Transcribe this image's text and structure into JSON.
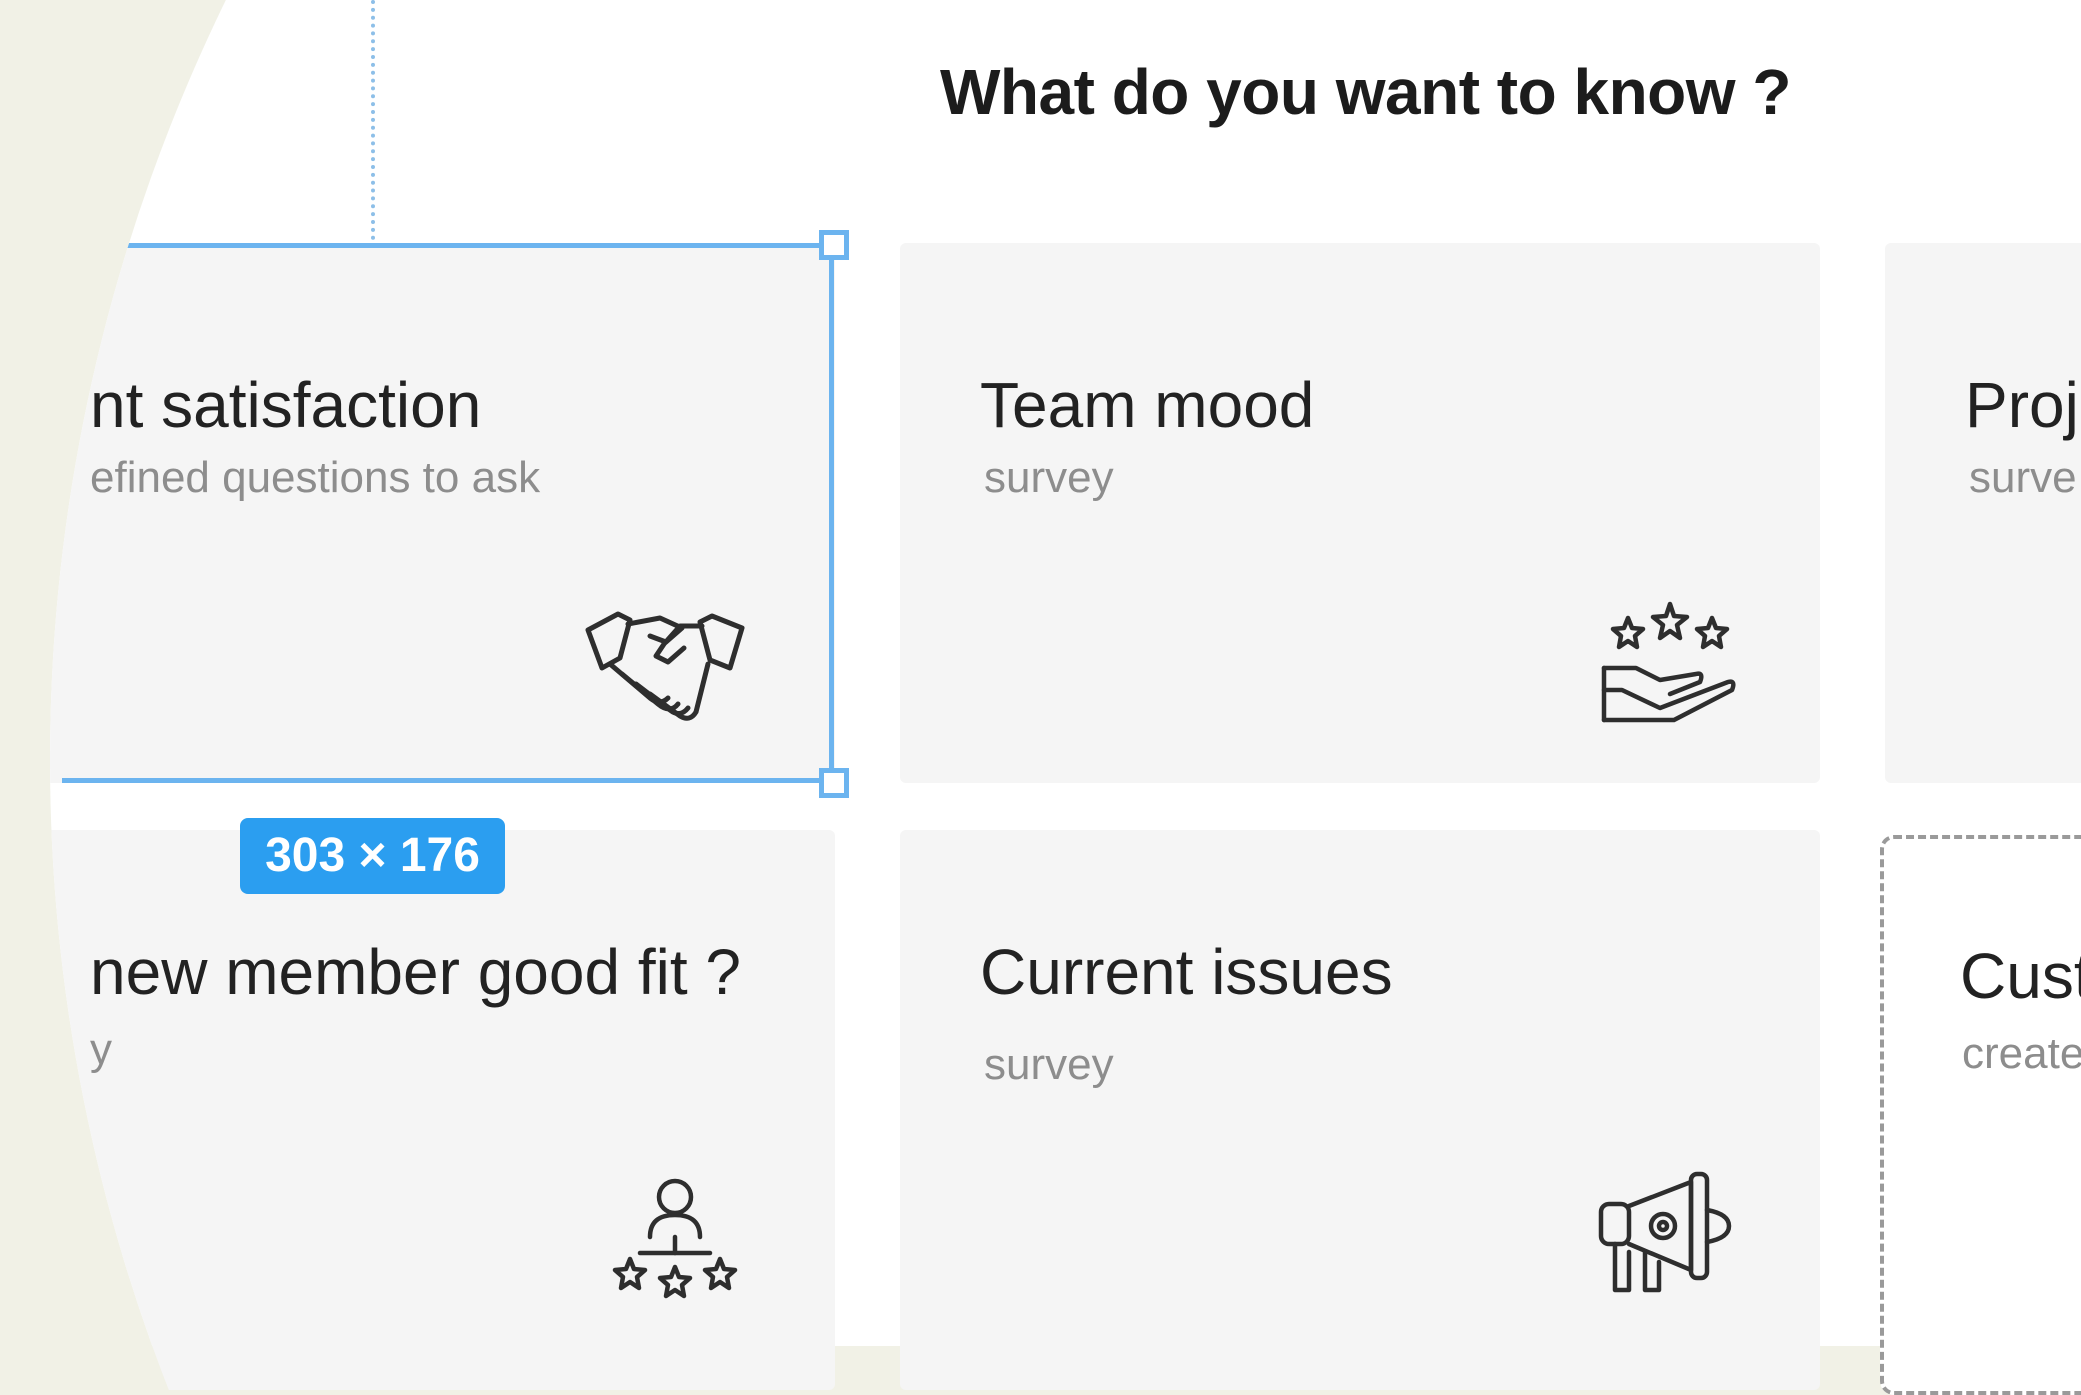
{
  "heading": "What do you want to know ?",
  "selection": {
    "size_label": "303 × 176"
  },
  "cards": [
    {
      "id": "client-satisfaction",
      "title": "nt satisfaction",
      "subtitle": "efined questions to ask",
      "icon": "handshake-icon"
    },
    {
      "id": "team-mood",
      "title": "Team mood",
      "subtitle": "survey",
      "icon": "hand-with-stars-icon"
    },
    {
      "id": "project",
      "title": "Proj",
      "subtitle": "surve",
      "icon": ""
    },
    {
      "id": "new-member-fit",
      "title": "new member good fit ?",
      "subtitle": "y",
      "icon": "person-with-stars-icon"
    },
    {
      "id": "current-issues",
      "title": "Current issues",
      "subtitle": "survey",
      "icon": "megaphone-icon"
    },
    {
      "id": "custom",
      "title": "Cust",
      "subtitle": "create",
      "icon": ""
    }
  ],
  "colors": {
    "selection": "#6cb4ef",
    "badge": "#2b9ef0",
    "card_background": "#f5f5f5",
    "outer_background": "#f1f1e6"
  }
}
